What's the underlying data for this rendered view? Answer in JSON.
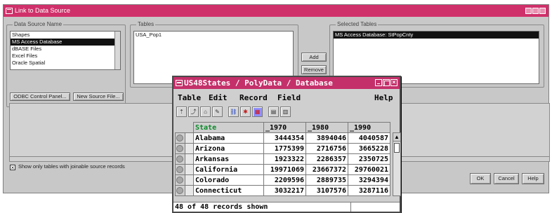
{
  "dialog": {
    "title": "Link to Data Source",
    "data_source": {
      "group_label": "Data Source Name",
      "items": [
        "Shapes",
        "MS Access Database",
        "dBASE Files",
        "Excel Files",
        "Oracle Spatial"
      ],
      "selected_index": 1
    },
    "tables": {
      "group_label": "Tables",
      "items": [
        "USA_Pop1"
      ]
    },
    "add_label": "Add",
    "remove_label": "Remove",
    "selected_tables": {
      "group_label": "Selected Tables",
      "items": [
        "MS Access Database: StPopCnty"
      ]
    },
    "odbc_button": "ODBC Control Panel...",
    "new_source_button": "New Source File...",
    "show_only_label": "Show only tables with joinable source records",
    "show_only_checked": true,
    "ok_label": "OK",
    "cancel_label": "Cancel",
    "help_label": "Help"
  },
  "window": {
    "title": "US48States / PolyData / Database",
    "menu": [
      "Table",
      "Edit",
      "Record",
      "Field",
      "Help"
    ],
    "toolbar_icons": [
      "record-up-icon",
      "field-up-icon",
      "home-icon",
      "edit-icon",
      "link-icon",
      "join-icon",
      "filter-icon",
      "save-icon",
      "table-icon"
    ],
    "table": {
      "columns": [
        "State",
        "_1970",
        "_1980",
        "_1990"
      ],
      "rows": [
        {
          "state": "Alabama",
          "y1970": "3444354",
          "y1980": "3894046",
          "y1990": "4040587"
        },
        {
          "state": "Arizona",
          "y1970": "1775399",
          "y1980": "2716756",
          "y1990": "3665228"
        },
        {
          "state": "Arkansas",
          "y1970": "1923322",
          "y1980": "2286357",
          "y1990": "2350725"
        },
        {
          "state": "California",
          "y1970": "19971069",
          "y1980": "23667372",
          "y1990": "29760021"
        },
        {
          "state": "Colorado",
          "y1970": "2209596",
          "y1980": "2889735",
          "y1990": "3294394"
        },
        {
          "state": "Connecticut",
          "y1970": "3032217",
          "y1980": "3107576",
          "y1990": "3287116"
        }
      ]
    },
    "status": "48 of 48 records shown"
  },
  "colors": {
    "title_bar": "#c4306a",
    "state_header": "#0a8a2a"
  }
}
